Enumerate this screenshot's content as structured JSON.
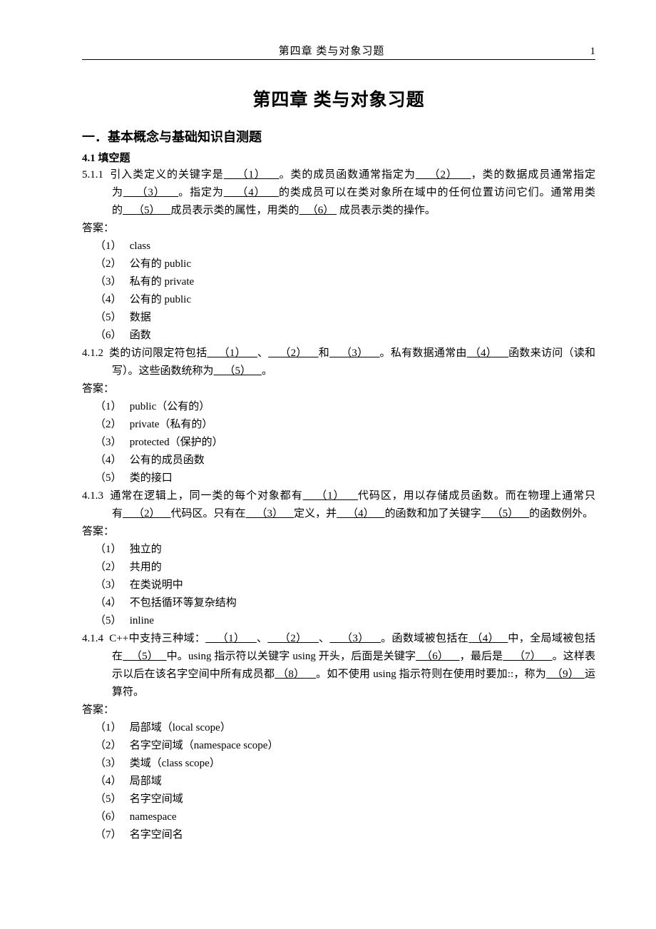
{
  "header": {
    "title": "第四章 类与对象习题",
    "page_number": "1"
  },
  "doc_title": "第四章 类与对象习题",
  "section1_title": "一．基本概念与基础知识自测题",
  "section4_1_title": "4.1 填空题",
  "q1": {
    "num": "5.1.1",
    "pre1": "引入类定义的关键字是",
    "b1": "（1）",
    "mid1": "。类的成员函数通常指定为",
    "b2": "（2）",
    "mid2": "，类的数据成员通常指定为",
    "b3": "（3）",
    "mid3": "。指定为",
    "b4": "（4）",
    "mid4": "的类成员可以在类对象所在域中的任何位置访问它们。通常用类的",
    "b5": "（5）",
    "mid5": "成员表示类的属性，用类的",
    "b6": "（6）",
    "mid6": " 成员表示类的操作。"
  },
  "answer_label": "答案：",
  "q1_answers": {
    "a1": "class",
    "a2": "公有的 public",
    "a3": "私有的 private",
    "a4": "公有的 public",
    "a5": "数据",
    "a6": "函数"
  },
  "q2": {
    "num": "4.1.2",
    "pre1": "类的访问限定符包括",
    "b1": "（1）",
    "sep1": "、",
    "b2": "（2）",
    "sep2": "和",
    "b3": "（3）",
    "mid1": "。私有数据通常由",
    "b4": "（4）",
    "mid2": "函数来访问（读和写）。这些函数统称为",
    "b5": "（5）",
    "mid3": "。"
  },
  "q2_answers": {
    "a1": "public（公有的）",
    "a2": "private（私有的）",
    "a3": "protected（保护的）",
    "a4": "公有的成员函数",
    "a5": "类的接口"
  },
  "q3": {
    "num": "4.1.3",
    "pre1": "通常在逻辑上，同一类的每个对象都有",
    "b1": "（1）",
    "mid1": "代码区，用以存储成员函数。而在物理上通常只有",
    "b2": "（2）",
    "mid2": "代码区。只有在",
    "b3": "（3）",
    "mid3": "定义，并",
    "b4": "（4）",
    "mid4": "的函数和加了关键字",
    "b5": "（5）",
    "mid5": "的函数例外。"
  },
  "q3_answers": {
    "a1": "独立的",
    "a2": "共用的",
    "a3": "在类说明中",
    "a4": "不包括循环等复杂结构",
    "a5": "inline"
  },
  "q4": {
    "num": "4.1.4",
    "pre1": "C++中支持三种域：",
    "b1": "（1）",
    "sep1": "、",
    "b2": "（2）",
    "sep2": "、",
    "b3": "（3）",
    "mid1": "。函数域被包括在",
    "b4": "（4）",
    "mid2": "中，全局域被包括在",
    "b5": "（5）",
    "mid3": "中。using 指示符以关键字 using 开头，后面是关键字",
    "b6": "（6）",
    "mid4": "，最后是",
    "b7": "（7）",
    "mid5": "。这样表示以后在该名字空间中所有成员都",
    "b8": "（8）",
    "mid6": "。如不使用 using 指示符则在使用时要加::，称为",
    "b9": "（9）",
    "mid7": "运算符。"
  },
  "q4_answers": {
    "a1": "局部域（local scope）",
    "a2": "名字空间域（namespace scope）",
    "a3": "类域（class scope）",
    "a4": "局部域",
    "a5": "名字空间域",
    "a6": "namespace",
    "a7": "名字空间名"
  },
  "paren": {
    "p1": "（1）",
    "p2": "（2）",
    "p3": "（3）",
    "p4": "（4）",
    "p5": "（5）",
    "p6": "（6）",
    "p7": "（7）"
  }
}
